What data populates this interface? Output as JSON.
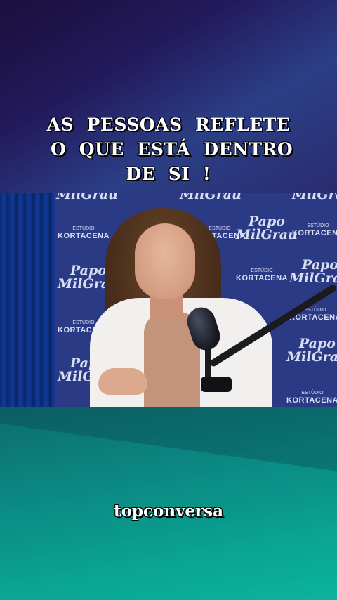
{
  "caption": {
    "lines": [
      "AS  PESSOAS  REFLETE",
      " O  QUE  ESTÁ  DENTRO",
      "DE  SI  !"
    ]
  },
  "video": {
    "backdrop_logos": {
      "papo": "Papo",
      "milgrau": "MilGrau",
      "estudio": "ESTÚDIO",
      "kortacena": "KORTACENA"
    }
  },
  "watermark": {
    "text": "topconversa"
  }
}
